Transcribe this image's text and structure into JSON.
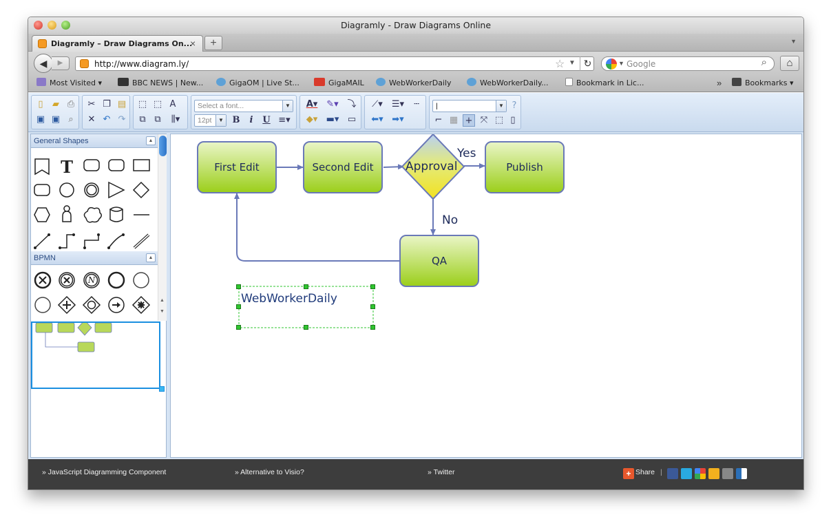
{
  "window": {
    "title": "Diagramly - Draw Diagrams Online"
  },
  "tab": {
    "title": "Diagramly – Draw Diagrams On..."
  },
  "address": {
    "url": "http://www.diagram.ly/"
  },
  "search": {
    "placeholder": "Google"
  },
  "bookmarks": [
    {
      "label": "Most Visited ▾"
    },
    {
      "label": "BBC NEWS | New..."
    },
    {
      "label": "GigaOM | Live St..."
    },
    {
      "label": "GigaMAIL"
    },
    {
      "label": "WebWorkerDaily"
    },
    {
      "label": "WebWorkerDaily..."
    },
    {
      "label": "Bookmark in Lic..."
    },
    {
      "label": "Bookmarks ▾"
    }
  ],
  "toolbar": {
    "font_placeholder": "Select a font...",
    "font_size": "12pt",
    "bold": "B",
    "italic": "i",
    "underline": "U",
    "text_color": "A"
  },
  "sidebar": {
    "general_title": "General Shapes",
    "bpmn_title": "BPMN",
    "text_shape": "T"
  },
  "diagram": {
    "nodes": [
      "First Edit",
      "Second Edit",
      "Approval",
      "Publish",
      "QA"
    ],
    "yes_label": "Yes",
    "no_label": "No",
    "text_box": "WebWorkerDaily"
  },
  "footer": {
    "links": [
      "» JavaScript Diagramming Component",
      "» Alternative to Visio?",
      "» Twitter"
    ],
    "share": "Share",
    "separator": "|"
  },
  "colors": {
    "node_fill": "#9ccf1c",
    "node_border": "#6a79b8",
    "edge": "#6a79b8",
    "selection": "#2fc52f",
    "footer": "#3d3d3d"
  }
}
